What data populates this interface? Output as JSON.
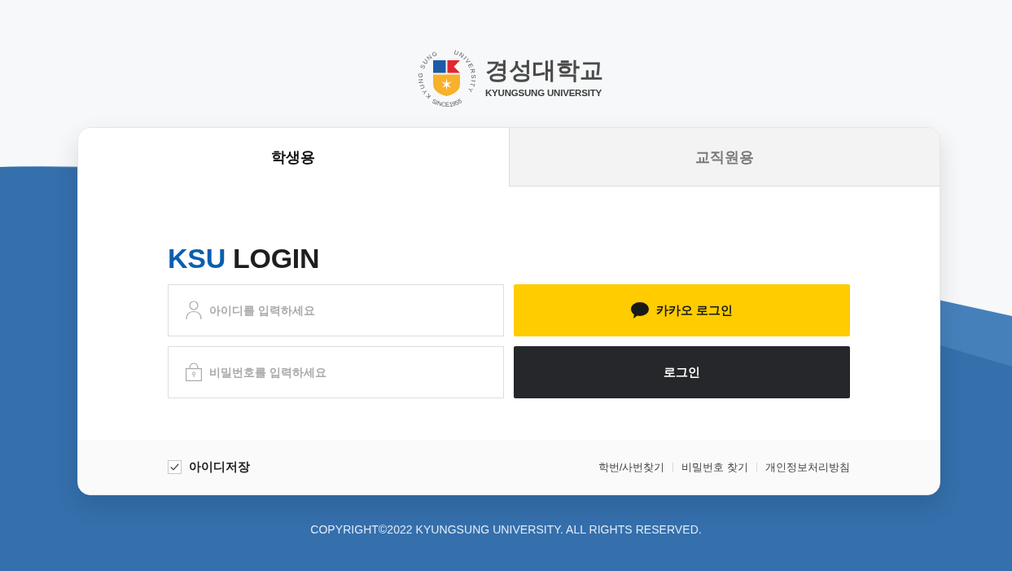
{
  "logo": {
    "ring_parts": [
      "KYUNG SUNG",
      "UNIVERSITY"
    ],
    "since_text": "SINCE1955",
    "name": "경성대학교",
    "name_en": "KYUNGSUNG UNIVERSITY"
  },
  "tabs": [
    {
      "label": "학생용",
      "selected": true
    },
    {
      "label": "교직원용",
      "selected": false
    }
  ],
  "login": {
    "title_accent": "KSU",
    "title": "LOGIN",
    "fields": [
      {
        "kind": "user",
        "placeholder": "아이디를 입력하세요"
      },
      {
        "kind": "password",
        "placeholder": "비밀번호를 입력하세요"
      }
    ],
    "buttons": [
      {
        "kind": "kakao",
        "label": "카카오 로그인"
      },
      {
        "kind": "primary",
        "label": "로그인"
      }
    ]
  },
  "remember": {
    "label": "아이디저장",
    "checked": true
  },
  "links": [
    "학번/사번찾기",
    "비밀번호 찾기",
    "개인정보처리방침"
  ],
  "footer": {
    "copyright": "COPYRIGHT©2022 KYUNGSUNG UNIVERSITY. ALL RIGHTS RESERVED."
  }
}
